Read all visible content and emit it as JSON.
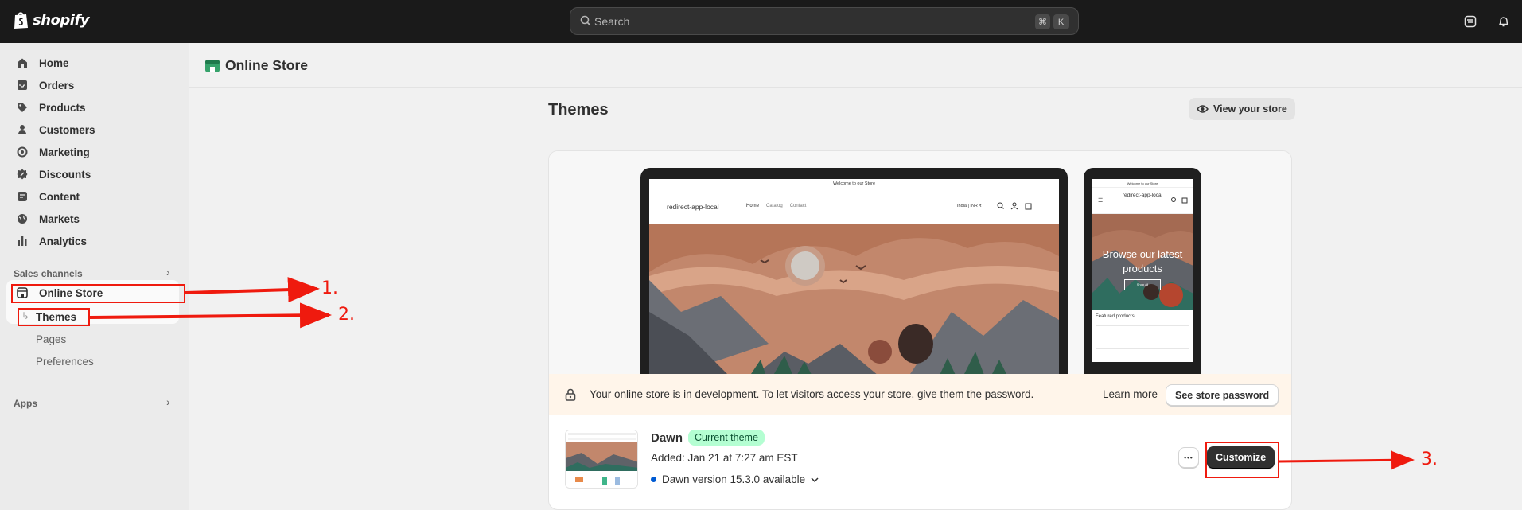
{
  "topbar": {
    "logo_text": "shopify",
    "search_placeholder": "Search",
    "shortcut_keys": [
      "⌘",
      "K"
    ]
  },
  "sidebar": {
    "items": [
      {
        "label": "Home",
        "icon": "home-icon"
      },
      {
        "label": "Orders",
        "icon": "inbox-icon"
      },
      {
        "label": "Products",
        "icon": "tag-icon"
      },
      {
        "label": "Customers",
        "icon": "person-icon"
      },
      {
        "label": "Marketing",
        "icon": "target-icon"
      },
      {
        "label": "Discounts",
        "icon": "discount-icon"
      },
      {
        "label": "Content",
        "icon": "content-icon"
      },
      {
        "label": "Markets",
        "icon": "globe-icon"
      },
      {
        "label": "Analytics",
        "icon": "bar-chart-icon"
      }
    ],
    "sales_channels_label": "Sales channels",
    "online_store_label": "Online Store",
    "sub_items": [
      "Themes",
      "Pages",
      "Preferences"
    ],
    "apps_label": "Apps"
  },
  "main": {
    "page_title": "Online Store",
    "section_title": "Themes",
    "view_store_label": "View your store",
    "preview": {
      "laptop_announcement": "Welcome to our Store",
      "store_name": "redirect-app-local",
      "nav_links": [
        "Home",
        "Catalog",
        "Contact"
      ],
      "locale": "India | INR ₹",
      "phone_announcement": "Welcome to our Store",
      "phone_store_name": "redirect-app-local",
      "phone_hero_text": "Browse our latest products",
      "phone_button": "Shop all",
      "phone_featured": "Featured products"
    },
    "banner": {
      "text": "Your online store is in development. To let visitors access your store, give them the password.",
      "learn_more": "Learn more",
      "button": "See store password"
    },
    "theme": {
      "name": "Dawn",
      "badge": "Current theme",
      "added": "Added: Jan 21 at 7:27 am EST",
      "version": "Dawn version 15.3.0 available",
      "more_label": "•••",
      "customize_label": "Customize"
    }
  },
  "annotations": [
    "1.",
    "2.",
    "3."
  ],
  "colors": {
    "topbar": "#1a1a1a",
    "annotation_red": "#ef1a0e",
    "badge_bg": "#b4fed2",
    "primary_button": "#303030",
    "banner_bg": "#fff5ea"
  }
}
